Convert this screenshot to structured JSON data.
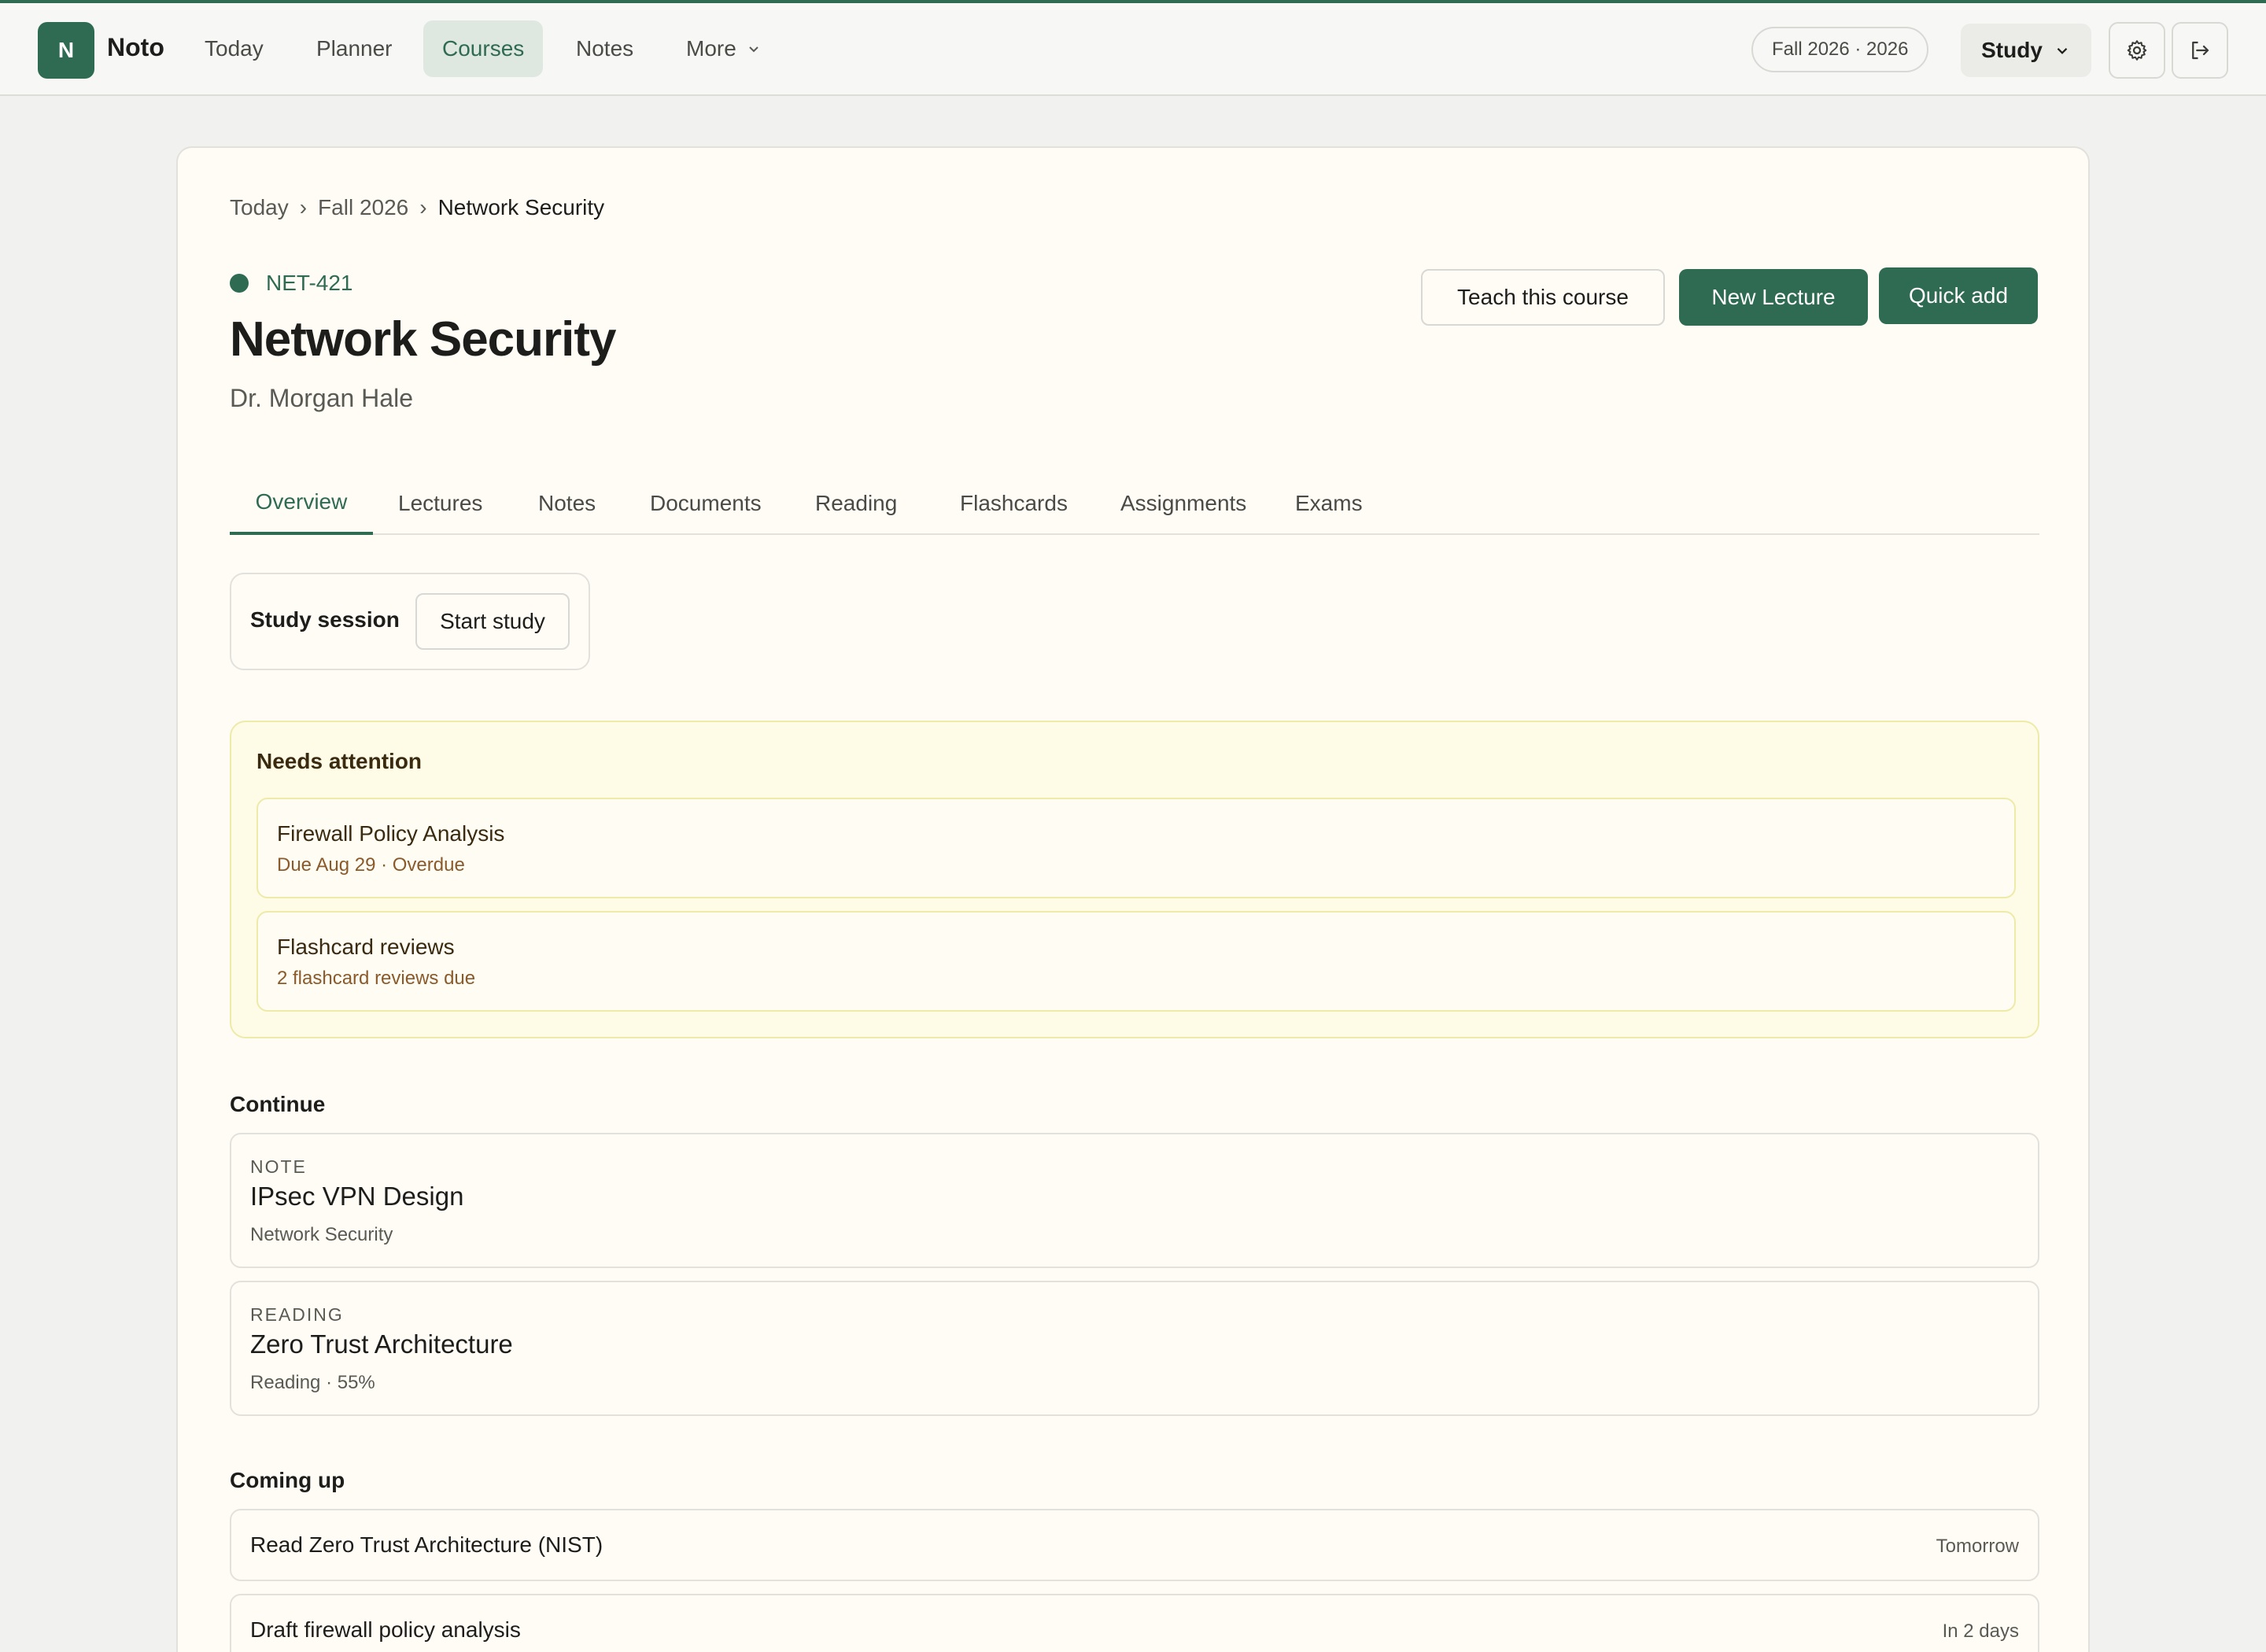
{
  "app": {
    "logo_letter": "N",
    "name": "Noto"
  },
  "nav": {
    "items": [
      {
        "label": "Today"
      },
      {
        "label": "Planner"
      },
      {
        "label": "Courses"
      },
      {
        "label": "Notes"
      },
      {
        "label": "More"
      }
    ],
    "term": "Fall 2026 · 2026",
    "mode": "Study"
  },
  "breadcrumb": {
    "items": [
      "Today",
      "Fall 2026",
      "Network Security"
    ],
    "separator": "›"
  },
  "course": {
    "code": "NET-421",
    "title": "Network Security",
    "instructor": "Dr. Morgan Hale"
  },
  "actions": {
    "teach": "Teach this course",
    "new_lecture": "New Lecture",
    "quick_add": "Quick add"
  },
  "tabs": [
    {
      "label": "Overview"
    },
    {
      "label": "Lectures"
    },
    {
      "label": "Notes"
    },
    {
      "label": "Documents"
    },
    {
      "label": "Reading"
    },
    {
      "label": "Flashcards"
    },
    {
      "label": "Assignments"
    },
    {
      "label": "Exams"
    }
  ],
  "session": {
    "label": "Study session",
    "button": "Start study"
  },
  "attention": {
    "title": "Needs attention",
    "items": [
      {
        "title": "Firewall Policy Analysis",
        "sub": "Due Aug 29 · Overdue"
      },
      {
        "title": "Flashcard reviews",
        "sub": "2 flashcard reviews due"
      }
    ]
  },
  "continue": {
    "title": "Continue",
    "items": [
      {
        "kind": "NOTE",
        "title": "IPsec VPN Design",
        "sub": "Network Security"
      },
      {
        "kind": "READING",
        "title": "Zero Trust Architecture",
        "sub": "Reading · 55%"
      }
    ]
  },
  "coming_up": {
    "title": "Coming up",
    "items": [
      {
        "title": "Read Zero Trust Architecture (NIST)",
        "when": "Tomorrow"
      },
      {
        "title": "Draft firewall policy analysis",
        "when": "In 2 days"
      }
    ]
  },
  "colors": {
    "accent": "#2f6b53",
    "attention_bg": "#fefbe6",
    "attention_border": "#eeeaa8"
  }
}
